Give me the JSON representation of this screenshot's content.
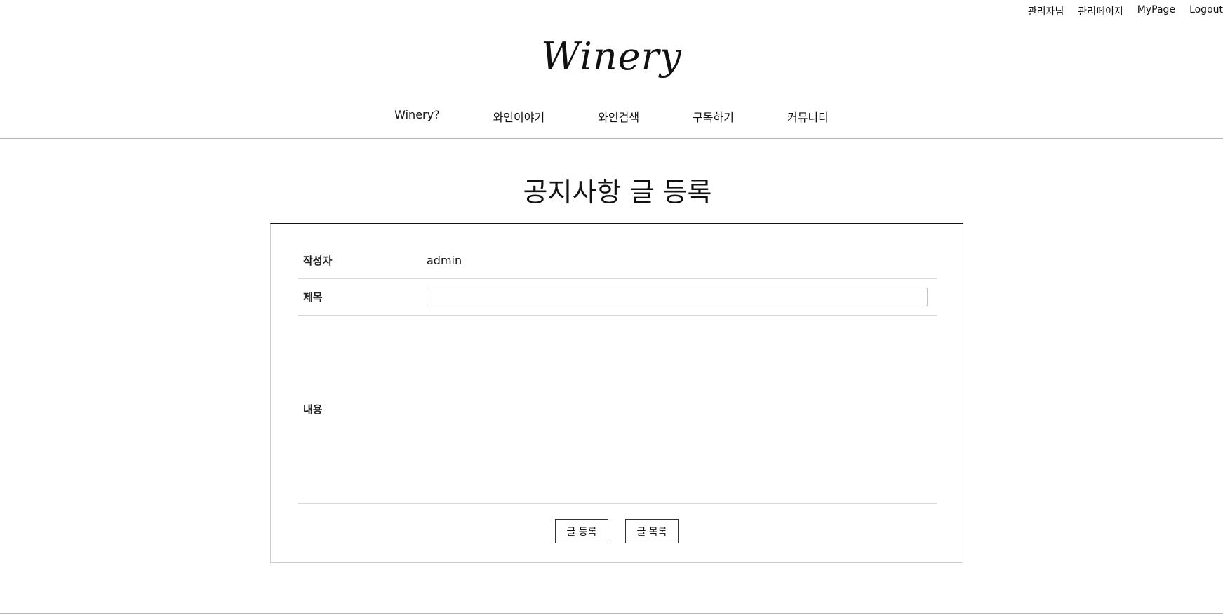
{
  "top_links": {
    "admin_name": "관리자님",
    "admin_page": "관리페이지",
    "mypage": "MyPage",
    "logout": "Logout"
  },
  "logo": {
    "text": "Winery"
  },
  "nav": {
    "items": [
      {
        "label": "Winery?"
      },
      {
        "label": "와인이야기"
      },
      {
        "label": "와인검색"
      },
      {
        "label": "구독하기"
      },
      {
        "label": "커뮤니티"
      }
    ]
  },
  "page": {
    "title": "공지사항 글 등록"
  },
  "form": {
    "writer_label": "작성자",
    "writer_value": "admin",
    "title_label": "제목",
    "title_value": "",
    "content_label": "내용",
    "content_value": ""
  },
  "buttons": {
    "submit": "글 등록",
    "list": "글 목록"
  }
}
